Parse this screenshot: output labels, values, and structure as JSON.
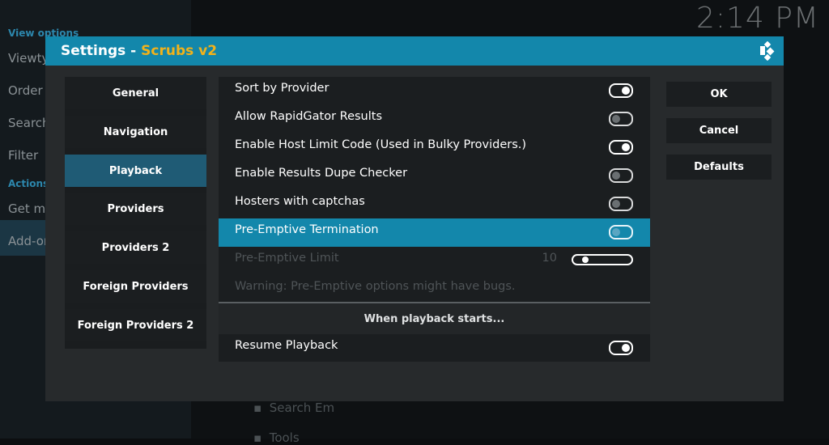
{
  "background": {
    "clock": "2:14 PM",
    "left_menu": {
      "view_options_header": "View options",
      "items": [
        "Viewty",
        "Order",
        "Search",
        "Filter"
      ],
      "actions_header": "Actions",
      "actions_items": [
        "Get mo",
        "Add-on"
      ]
    },
    "bottom_items": [
      "Search Em",
      "Tools"
    ]
  },
  "dialog": {
    "title_prefix": "Settings",
    "title_sep": " - ",
    "title_addon": "Scrubs v2",
    "addon_color": "#f2b21a",
    "header_color": "#1387ab"
  },
  "categories": [
    {
      "label": "General",
      "selected": false
    },
    {
      "label": "Navigation",
      "selected": false
    },
    {
      "label": "Playback",
      "selected": true
    },
    {
      "label": "Providers",
      "selected": false
    },
    {
      "label": "Providers 2",
      "selected": false
    },
    {
      "label": "Foreign Providers",
      "selected": false
    },
    {
      "label": "Foreign Providers 2",
      "selected": false
    }
  ],
  "settings": [
    {
      "label": "Sort by Provider",
      "type": "toggle",
      "on": true
    },
    {
      "label": "Allow RapidGator Results",
      "type": "toggle",
      "on": false
    },
    {
      "label": "Enable Host Limit Code (Used in Bulky Providers.)",
      "type": "toggle",
      "on": true
    },
    {
      "label": "Enable Results Dupe Checker",
      "type": "toggle",
      "on": false
    },
    {
      "label": "Hosters with captchas",
      "type": "toggle",
      "on": false
    },
    {
      "label": "Pre-Emptive Termination",
      "type": "toggle",
      "on": false,
      "selected": true
    },
    {
      "label": "Pre-Emptive Limit",
      "type": "slider",
      "value": "10",
      "fraction": 0.05,
      "disabled": true
    },
    {
      "label": "Warning: Pre-Emptive options might have bugs.",
      "type": "text",
      "disabled": true
    }
  ],
  "section_header": "When playback starts...",
  "post_settings": [
    {
      "label": "Resume Playback",
      "type": "toggle",
      "on": true
    }
  ],
  "buttons": {
    "ok": "OK",
    "cancel": "Cancel",
    "defaults": "Defaults"
  }
}
